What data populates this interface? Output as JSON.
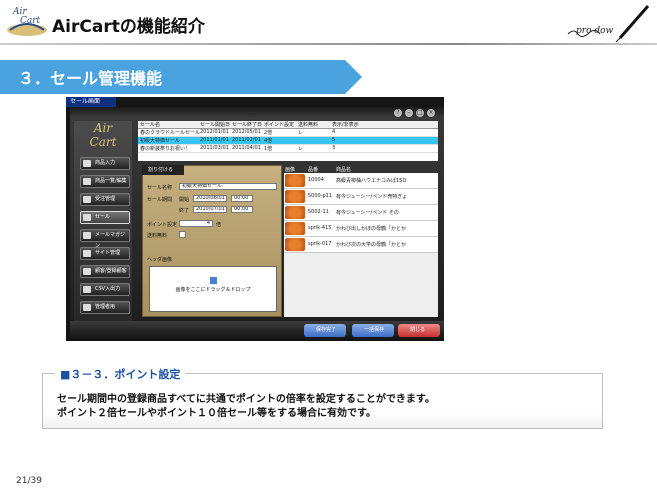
{
  "header": {
    "app_title": "AirCartの機能紹介",
    "logo_text_1": "Air",
    "logo_text_2": "Cart",
    "signature": "pro dow"
  },
  "section": {
    "title": "３．セール管理機能"
  },
  "screenshot": {
    "tab_label": "セール画面",
    "side_logo_1": "Air",
    "side_logo_2": "Cart",
    "window_buttons": [
      "?",
      "–",
      "□",
      "×"
    ],
    "nav": [
      {
        "label": "商品入力"
      },
      {
        "label": "商品一覧/編集"
      },
      {
        "label": "受注管理"
      },
      {
        "label": "セール"
      },
      {
        "label": "メールマガジン"
      },
      {
        "label": "サイト管理"
      },
      {
        "label": "顧客/登録顧客"
      },
      {
        "label": "CSV入出力"
      },
      {
        "label": "管理者用"
      }
    ],
    "table": {
      "headers": [
        "セール名",
        "セール開始日",
        "セール終了日",
        "ポイント設定",
        "送料無料",
        "表示/非表示"
      ],
      "rows": [
        {
          "name": "春のクラウドルールセール",
          "start": "2012/01/01",
          "end": "2012/05/01",
          "point": "2倍",
          "free": "レ",
          "flag": "4"
        },
        {
          "name": "初級大特価セール",
          "start": "2011/01/01",
          "end": "2011/02/01",
          "point": "4倍",
          "free": "",
          "flag": "5"
        },
        {
          "name": "春の新装祭りお祝い！",
          "start": "2011/03/01",
          "end": "2011/04/01",
          "point": "1倍",
          "free": "レ",
          "flag": "3"
        }
      ]
    },
    "form": {
      "tab": "割り付ける",
      "sale_name_label": "セール名称",
      "sale_name_value": "初級大特価セール",
      "period_label": "セール期間",
      "start_label": "開始",
      "start_date": "2010/06/01",
      "start_time": "00:00",
      "end_label": "終了",
      "end_date": "2010/07/01",
      "end_time": "00:00",
      "point_label": "ポイント設定",
      "point_value": "4",
      "point_unit": "倍",
      "free_label": "送料無料",
      "header_image_label": "ヘッダ画像",
      "drop_text": "画像をここにドラッグ＆ドロップ"
    },
    "right_table": {
      "headers": [
        "画像",
        "品番",
        "商品名"
      ],
      "rows": [
        {
          "code": "10004",
          "name": "高級青柳柚ハウエナコみぱ15D"
        },
        {
          "code": "5000-p11",
          "name": "有今ジューシー/ペンド売特ぎょ"
        },
        {
          "code": "5002-11",
          "name": "有今ジューシー/ペンド その"
        },
        {
          "code": "sprik-415",
          "name": "かわび出しかぼの母鶴「かとか"
        },
        {
          "code": "sprik-017",
          "name": "かわび次の大学の母鶴「かとか"
        }
      ]
    },
    "buttons": [
      "保存完了",
      "一括保存",
      "閉じる"
    ]
  },
  "caption": {
    "title": "■３－３．ポイント設定",
    "line1": "セール期間中の登録商品すべてに共通でポイントの倍率を設定することができます。",
    "line2": "ポイント２倍セールやポイント１０倍セール等をする場合に有効です。"
  },
  "page": {
    "number": "21/39"
  }
}
